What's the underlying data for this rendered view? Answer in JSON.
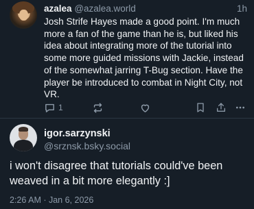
{
  "parent_post": {
    "display_name": "azalea",
    "handle": "@azalea.world",
    "time": "1h",
    "text": "Josh Strife Hayes made a good point. I'm much more a fan of the game than he is, but liked his idea about integrating more of the tutorial into some more guided missions with Jackie, instead of the somewhat jarring T-Bug section. Have the player be introduced to combat in Night City, not VR.",
    "reply_count": "1",
    "action_icons": [
      "reply-icon",
      "repost-icon",
      "like-icon",
      "bookmark-icon",
      "share-icon",
      "more-icon"
    ]
  },
  "main_post": {
    "display_name": "igor.sarzynski",
    "handle": "@srznsk.bsky.social",
    "text": "i won't disagree that tutorials could've been weaved in a bit more elegantly :]",
    "timestamp": "2:26 AM · Jan 6, 2026"
  },
  "colors": {
    "background": "#161e27",
    "text": "#f1f3f5",
    "muted": "#8d9aa8",
    "divider": "#2b3643"
  }
}
